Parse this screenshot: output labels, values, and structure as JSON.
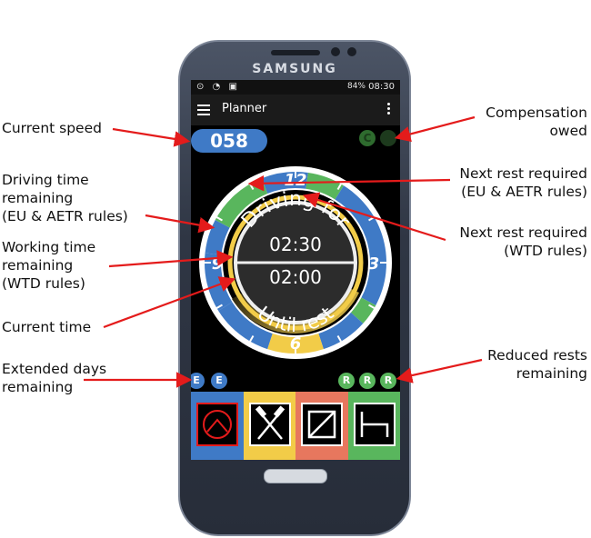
{
  "annotations": {
    "current_speed": "Current speed",
    "driving_time": "Driving time\nremaining\n(EU & AETR rules)",
    "working_time": "Working time\nremaining\n(WTD rules)",
    "current_time": "Current time",
    "extended_days": "Extended days\nremaining",
    "compensation": "Compensation\nowed",
    "next_rest_eu": "Next rest required\n(EU & AETR rules)",
    "next_rest_wtd": "Next rest required\n(WTD rules)",
    "reduced_rests": "Reduced rests\nremaining"
  },
  "phone": {
    "brand": "SAMSUNG"
  },
  "status_bar": {
    "battery": "84%",
    "time": "08:30"
  },
  "app_bar": {
    "title": "Planner"
  },
  "speed": "058",
  "compensation_badge": "C",
  "dial": {
    "top_text": "Driving for",
    "time_top": "02:30",
    "time_bottom": "02:00",
    "bottom_text": "Until rest",
    "hours": [
      "12",
      "3",
      "6",
      "9"
    ]
  },
  "extended_badges": [
    "E",
    "E"
  ],
  "reduced_badges": [
    "R",
    "R",
    "R"
  ],
  "activity_tiles": [
    {
      "icon": "driving-wheel-icon",
      "color": "#3f7ac6",
      "selected": true
    },
    {
      "icon": "work-hammers-icon",
      "color": "#f2cc48",
      "selected": false
    },
    {
      "icon": "availability-icon",
      "color": "#e7775e",
      "selected": false
    },
    {
      "icon": "rest-bed-icon",
      "color": "#59b65d",
      "selected": false
    }
  ],
  "colors": {
    "blue": "#3f7ac6",
    "green": "#59b65d",
    "yellow": "#f2cc48",
    "orange": "#e7775e",
    "arrow": "#e41b1b"
  }
}
